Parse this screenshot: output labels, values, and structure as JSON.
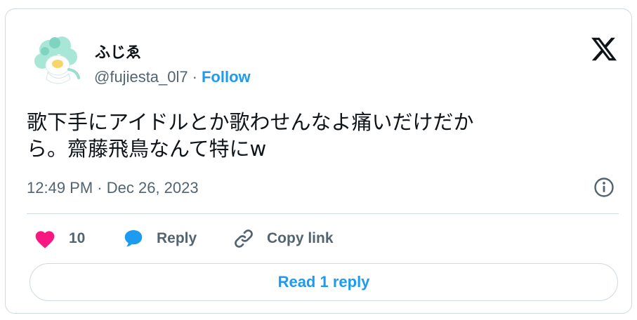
{
  "author": {
    "display_name": "ふじゑ",
    "handle": "@fujiesta_0l7",
    "separator": "·",
    "follow_label": "Follow"
  },
  "tweet": {
    "text_lines": [
      "歌下手にアイドルとか歌わせんなよ痛いだけだか",
      "ら。齋藤飛鳥なんて特にw"
    ],
    "timestamp": "12:49 PM · Dec 26, 2023"
  },
  "actions": {
    "like_count": "10",
    "reply_label": "Reply",
    "copy_link_label": "Copy link"
  },
  "read_reply_label": "Read 1 reply",
  "colors": {
    "accent": "#1d9bf0",
    "like": "#f91880",
    "text_secondary": "#536471",
    "border": "#cfd9de"
  },
  "icons": {
    "brand": "x-logo-icon",
    "info": "info-icon",
    "like": "heart-icon",
    "reply": "speech-bubble-icon",
    "copy_link": "link-icon"
  }
}
